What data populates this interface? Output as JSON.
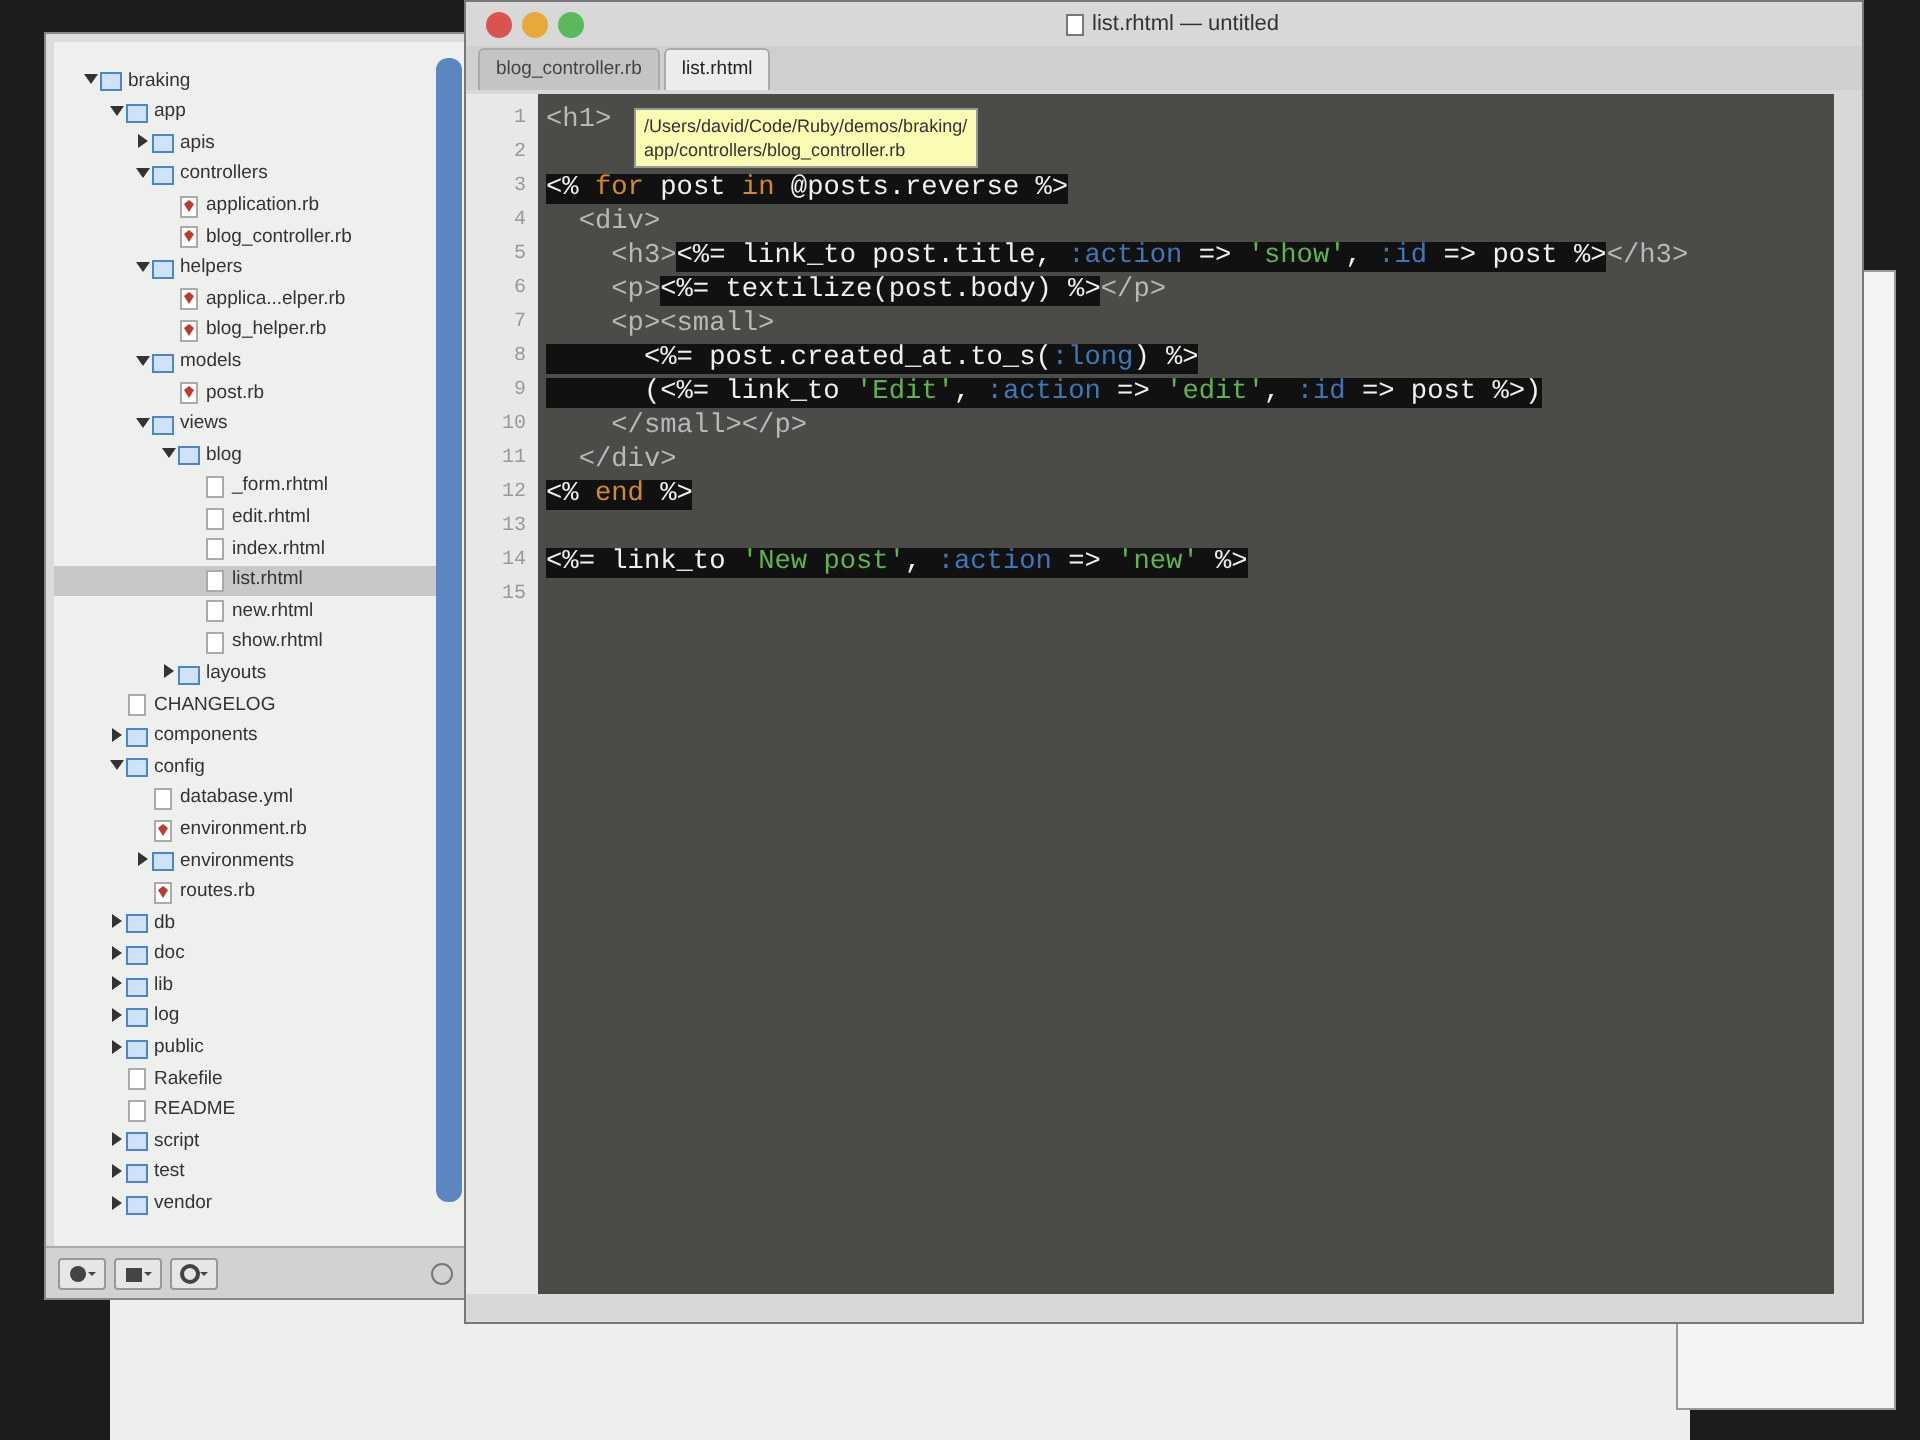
{
  "window": {
    "title": "list.rhtml — untitled"
  },
  "tabs": [
    {
      "label": "blog_controller.rb",
      "selected": false
    },
    {
      "label": "list.rhtml",
      "selected": true
    }
  ],
  "tooltip": {
    "lines": [
      "/Users/david/Code/Ruby/demos/braking/",
      "app/controllers/blog_controller.rb"
    ]
  },
  "project_tree": [
    {
      "label": "braking",
      "kind": "folder",
      "expanded": true,
      "selected": false,
      "children": [
        {
          "label": "app",
          "kind": "folder",
          "expanded": true,
          "selected": false,
          "children": [
            {
              "label": "apis",
              "kind": "folder",
              "expanded": false,
              "selected": false
            },
            {
              "label": "controllers",
              "kind": "folder",
              "expanded": true,
              "selected": false,
              "children": [
                {
                  "label": "application.rb",
                  "kind": "ruby",
                  "selected": false
                },
                {
                  "label": "blog_controller.rb",
                  "kind": "ruby",
                  "selected": false
                }
              ]
            },
            {
              "label": "helpers",
              "kind": "folder",
              "expanded": true,
              "selected": false,
              "children": [
                {
                  "label": "applica...elper.rb",
                  "kind": "ruby",
                  "selected": false
                },
                {
                  "label": "blog_helper.rb",
                  "kind": "ruby",
                  "selected": false
                }
              ]
            },
            {
              "label": "models",
              "kind": "folder",
              "expanded": true,
              "selected": false,
              "children": [
                {
                  "label": "post.rb",
                  "kind": "ruby",
                  "selected": false
                }
              ]
            },
            {
              "label": "views",
              "kind": "folder",
              "expanded": true,
              "selected": false,
              "children": [
                {
                  "label": "blog",
                  "kind": "folder",
                  "expanded": true,
                  "selected": false,
                  "children": [
                    {
                      "label": "_form.rhtml",
                      "kind": "file",
                      "selected": false
                    },
                    {
                      "label": "edit.rhtml",
                      "kind": "file",
                      "selected": false
                    },
                    {
                      "label": "index.rhtml",
                      "kind": "file",
                      "selected": false
                    },
                    {
                      "label": "list.rhtml",
                      "kind": "file",
                      "selected": true
                    },
                    {
                      "label": "new.rhtml",
                      "kind": "file",
                      "selected": false
                    },
                    {
                      "label": "show.rhtml",
                      "kind": "file",
                      "selected": false
                    }
                  ]
                },
                {
                  "label": "layouts",
                  "kind": "folder",
                  "expanded": false,
                  "selected": false
                }
              ]
            }
          ]
        },
        {
          "label": "CHANGELOG",
          "kind": "file",
          "selected": false
        },
        {
          "label": "components",
          "kind": "folder",
          "expanded": false,
          "selected": false
        },
        {
          "label": "config",
          "kind": "folder",
          "expanded": true,
          "selected": false,
          "children": [
            {
              "label": "database.yml",
              "kind": "file",
              "selected": false
            },
            {
              "label": "environment.rb",
              "kind": "ruby",
              "selected": false
            },
            {
              "label": "environments",
              "kind": "folder",
              "expanded": false,
              "selected": false
            },
            {
              "label": "routes.rb",
              "kind": "ruby",
              "selected": false
            }
          ]
        },
        {
          "label": "db",
          "kind": "folder",
          "expanded": false,
          "selected": false
        },
        {
          "label": "doc",
          "kind": "folder",
          "expanded": false,
          "selected": false
        },
        {
          "label": "lib",
          "kind": "folder",
          "expanded": false,
          "selected": false
        },
        {
          "label": "log",
          "kind": "folder",
          "expanded": false,
          "selected": false
        },
        {
          "label": "public",
          "kind": "folder",
          "expanded": false,
          "selected": false
        },
        {
          "label": "Rakefile",
          "kind": "file",
          "selected": false
        },
        {
          "label": "README",
          "kind": "file",
          "selected": false
        },
        {
          "label": "script",
          "kind": "folder",
          "expanded": false,
          "selected": false
        },
        {
          "label": "test",
          "kind": "folder",
          "expanded": false,
          "selected": false
        },
        {
          "label": "vendor",
          "kind": "folder",
          "expanded": false,
          "selected": false
        }
      ]
    }
  ],
  "code_lines": [
    {
      "number": "1",
      "segments": [
        {
          "text": "<h1>",
          "kind": "tag",
          "embedded": false
        }
      ]
    },
    {
      "number": "2"
    },
    {
      "number": "3",
      "segments": [
        {
          "text": "<% ",
          "kind": "plain",
          "embedded": true
        },
        {
          "text": "for",
          "kind": "keyword",
          "embedded": true
        },
        {
          "text": " post ",
          "kind": "plain",
          "embedded": true
        },
        {
          "text": "in",
          "kind": "keyword",
          "embedded": true
        },
        {
          "text": " @posts.reverse %>",
          "kind": "plain",
          "embedded": true
        }
      ]
    },
    {
      "number": "4",
      "segments": [
        {
          "text": "  <div>",
          "kind": "tag",
          "embedded": false
        }
      ]
    },
    {
      "number": "5",
      "segments": [
        {
          "text": "    <h3>",
          "kind": "tag",
          "embedded": false
        },
        {
          "text": "<%= link_to post.title, ",
          "kind": "plain",
          "embedded": true
        },
        {
          "text": ":action",
          "kind": "symbol",
          "embedded": true
        },
        {
          "text": " => ",
          "kind": "plain",
          "embedded": true
        },
        {
          "text": "'show'",
          "kind": "string",
          "embedded": true
        },
        {
          "text": ", ",
          "kind": "plain",
          "embedded": true
        },
        {
          "text": ":id",
          "kind": "symbol",
          "embedded": true
        },
        {
          "text": " => post %>",
          "kind": "plain",
          "embedded": true
        },
        {
          "text": "</h3>",
          "kind": "tag",
          "embedded": false
        }
      ]
    },
    {
      "number": "6",
      "segments": [
        {
          "text": "    <p>",
          "kind": "tag",
          "embedded": false
        },
        {
          "text": "<%= textilize(post.body) %>",
          "kind": "plain",
          "embedded": true
        },
        {
          "text": "</p>",
          "kind": "tag",
          "embedded": false
        }
      ]
    },
    {
      "number": "7",
      "segments": [
        {
          "text": "    <p><small>",
          "kind": "tag",
          "embedded": false
        }
      ]
    },
    {
      "number": "8",
      "segments": [
        {
          "text": "      <%= post.created_at.to_s(",
          "kind": "plain",
          "embedded": true
        },
        {
          "text": ":long",
          "kind": "symbol",
          "embedded": true
        },
        {
          "text": ") %>",
          "kind": "plain",
          "embedded": true
        }
      ]
    },
    {
      "number": "9",
      "segments": [
        {
          "text": "      (<%= link_to ",
          "kind": "plain",
          "embedded": true
        },
        {
          "text": "'Edit'",
          "kind": "string",
          "embedded": true
        },
        {
          "text": ", ",
          "kind": "plain",
          "embedded": true
        },
        {
          "text": ":action",
          "kind": "symbol",
          "embedded": true
        },
        {
          "text": " => ",
          "kind": "plain",
          "embedded": true
        },
        {
          "text": "'edit'",
          "kind": "string",
          "embedded": true
        },
        {
          "text": ", ",
          "kind": "plain",
          "embedded": true
        },
        {
          "text": ":id",
          "kind": "symbol",
          "embedded": true
        },
        {
          "text": " => post %>)",
          "kind": "plain",
          "embedded": true
        }
      ]
    },
    {
      "number": "10",
      "segments": [
        {
          "text": "    </small></p>",
          "kind": "tag",
          "embedded": false
        }
      ]
    },
    {
      "number": "11",
      "segments": [
        {
          "text": "  </div>",
          "kind": "tag",
          "embedded": false
        }
      ]
    },
    {
      "number": "12",
      "segments": [
        {
          "text": "<% ",
          "kind": "plain",
          "embedded": true
        },
        {
          "text": "end",
          "kind": "keyword",
          "embedded": true
        },
        {
          "text": " %>",
          "kind": "plain",
          "embedded": true
        }
      ]
    },
    {
      "number": "13"
    },
    {
      "number": "14",
      "segments": [
        {
          "text": "<%= link_to ",
          "kind": "plain",
          "embedded": true
        },
        {
          "text": "'New post'",
          "kind": "string",
          "embedded": true
        },
        {
          "text": ", ",
          "kind": "plain",
          "embedded": true
        },
        {
          "text": ":action",
          "kind": "symbol",
          "embedded": true
        },
        {
          "text": " => ",
          "kind": "plain",
          "embedded": true
        },
        {
          "text": "'new'",
          "kind": "string",
          "embedded": true
        },
        {
          "text": " %>",
          "kind": "plain",
          "embedded": true
        }
      ]
    },
    {
      "number": "15"
    }
  ]
}
